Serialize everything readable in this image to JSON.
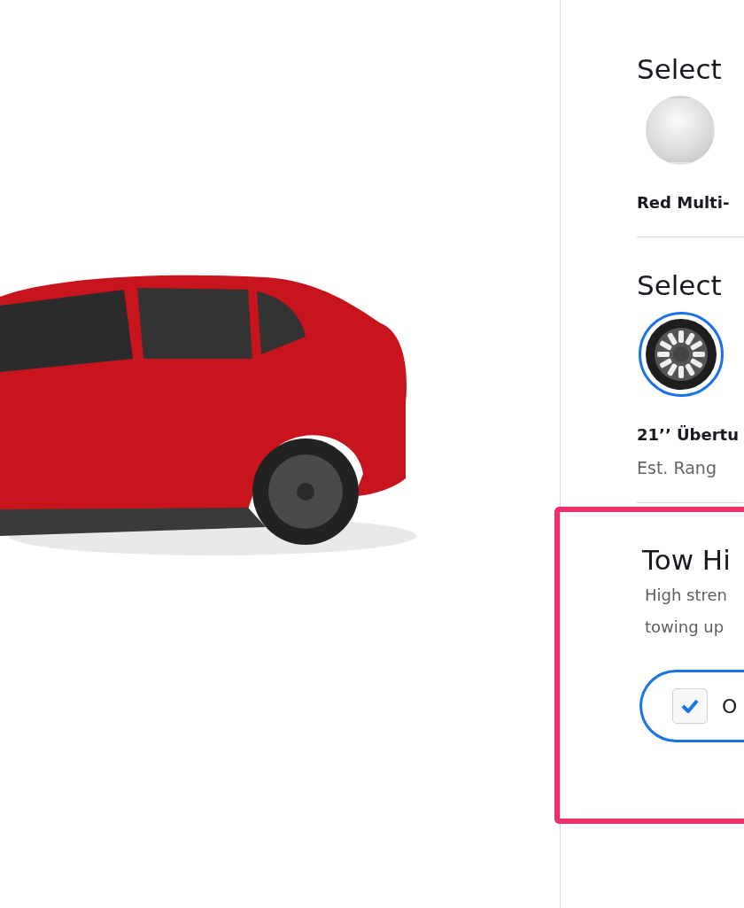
{
  "paint": {
    "heading": "Select",
    "swatches": [
      {
        "selected": false
      }
    ],
    "label": "Red Multi-"
  },
  "wheels": {
    "heading": "Select",
    "options": [
      {
        "selected": true
      }
    ],
    "name": "21’’ Übertu",
    "range": "Est. Rang"
  },
  "tow_hitch": {
    "highlighted": true,
    "title": "Tow Hi",
    "description_lines": [
      "High stren",
      "towing up"
    ],
    "option": {
      "checked": true,
      "label": "O"
    }
  }
}
